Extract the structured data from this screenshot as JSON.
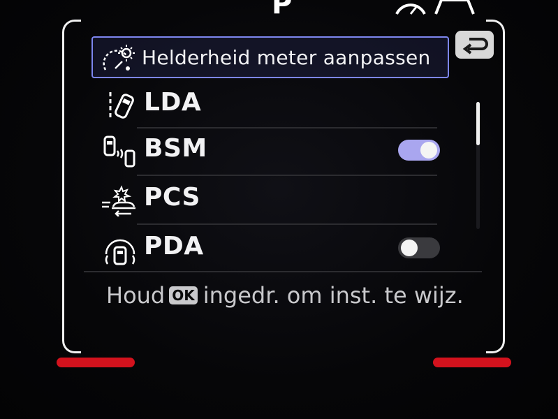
{
  "status": {
    "gear": "P",
    "gear_icon": "gauge-and-car-icons"
  },
  "header": {
    "label": "Helderheid meter aanpassen",
    "icon": "meter-brightness-icon"
  },
  "back_button": {
    "icon": "return-arrow-icon"
  },
  "items": [
    {
      "label": "LDA",
      "icon": "lane-departure-icon",
      "toggle": null
    },
    {
      "label": "BSM",
      "icon": "blind-spot-monitor-icon",
      "toggle": "on"
    },
    {
      "label": "PCS",
      "icon": "pre-collision-icon",
      "toggle": null
    },
    {
      "label": "PDA",
      "icon": "proactive-driving-icon",
      "toggle": "off"
    }
  ],
  "footer": {
    "prefix": "Houd",
    "key": "OK",
    "suffix": "ingedr. om inst. te wijz."
  },
  "colors": {
    "accent": "#7d86f0",
    "toggle_on": "#a9a6ef",
    "toggle_off": "#3a3a3e",
    "indicator": "#d3121d"
  }
}
